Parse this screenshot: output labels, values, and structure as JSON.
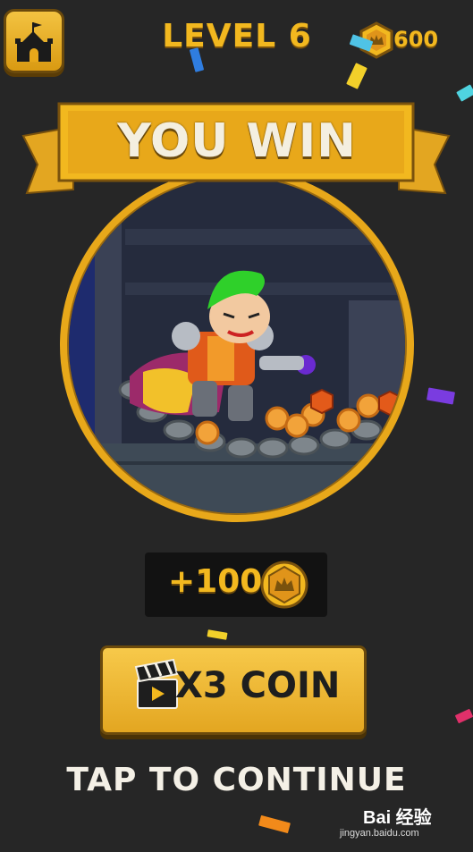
{
  "header": {
    "level_title": "LEVEL 6",
    "coin_count": "600",
    "home_icon": "castle-icon",
    "coin_icon": "crown-coin-icon"
  },
  "banner": {
    "title": "YOU WIN"
  },
  "reward": {
    "amount": "+100",
    "icon": "crown-coin-icon"
  },
  "multiplier_button": {
    "label": "X3 COIN",
    "icon": "clapperboard-icon"
  },
  "continue": {
    "label": "TAP TO CONTINUE"
  },
  "watermark": {
    "logo": "Bai  经验",
    "url": "jingyan.baidu.com"
  },
  "colors": {
    "background": "#262626",
    "gold": "#f2b81f",
    "gold_dark": "#6b4a0c",
    "text_light": "#f4f0e6"
  }
}
